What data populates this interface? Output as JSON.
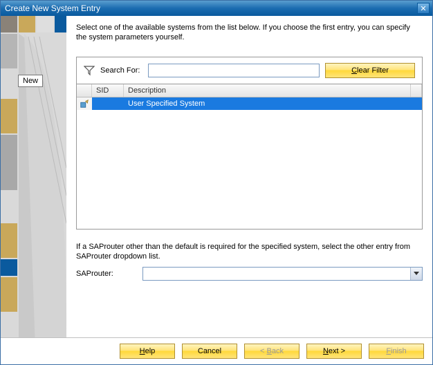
{
  "window": {
    "title": "Create New System Entry"
  },
  "sidebar": {
    "new_label": "New"
  },
  "intro": "Select one of the available systems from the list below. If you choose the first entry, you can specify the system parameters yourself.",
  "filter": {
    "label": "Search For:",
    "value": "",
    "clear": "Clear Filter",
    "clear_u": "C"
  },
  "table": {
    "col_sid": "SID",
    "col_desc": "Description",
    "rows": [
      {
        "sid": "",
        "desc": "User Specified System",
        "selected": true
      }
    ]
  },
  "note": "If a SAProuter other than the default is required for the specified system, select the other entry from SAProuter dropdown list.",
  "router": {
    "label": "SAProuter:",
    "value": ""
  },
  "footer": {
    "help": "Help",
    "help_u": "H",
    "cancel": "Cancel",
    "back": "< Back",
    "back_u": "B",
    "next": "Next >",
    "next_u": "N",
    "finish": "Finish",
    "finish_u": "F"
  }
}
